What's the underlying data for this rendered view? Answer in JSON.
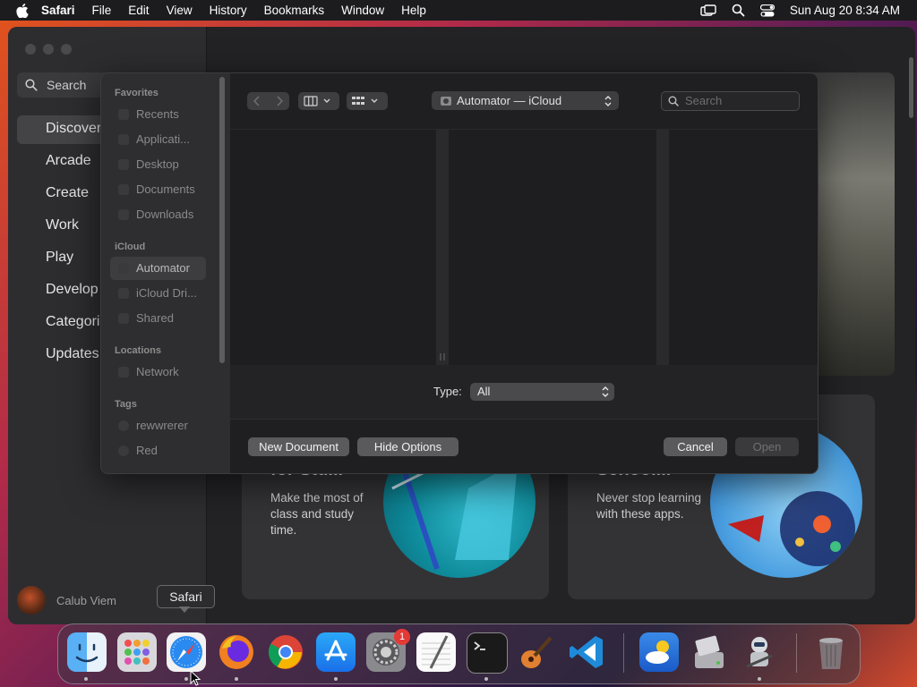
{
  "menubar": {
    "app_name": "Safari",
    "items": [
      "File",
      "Edit",
      "View",
      "History",
      "Bookmarks",
      "Window",
      "Help"
    ],
    "clock": "Sun Aug 20  8:34 AM"
  },
  "appstore": {
    "search_placeholder": "Search",
    "nav": [
      {
        "label": "Discover",
        "selected": true
      },
      {
        "label": "Arcade"
      },
      {
        "label": "Create"
      },
      {
        "label": "Work"
      },
      {
        "label": "Play"
      },
      {
        "label": "Develop"
      },
      {
        "label": "Categories"
      },
      {
        "label": "Updates"
      }
    ],
    "user": "Calub Viem",
    "cards": [
      {
        "title": "for Stu...",
        "text": "Make the most of class and study time."
      },
      {
        "title": "School...",
        "text": "Never stop learning with these apps."
      }
    ]
  },
  "dialog": {
    "sidebar": {
      "favorites_label": "Favorites",
      "favorites": [
        "Recents",
        "Applicati...",
        "Desktop",
        "Documents",
        "Downloads"
      ],
      "icloud_label": "iCloud",
      "icloud": [
        "Automator",
        "iCloud Dri...",
        "Shared"
      ],
      "locations_label": "Locations",
      "locations": [
        "Network"
      ],
      "tags_label": "Tags",
      "tags": [
        "rewwrerer",
        "Red"
      ]
    },
    "location": "Automator — iCloud",
    "search_placeholder": "Search",
    "type_label": "Type:",
    "type_value": "All",
    "buttons": {
      "new_document": "New Document",
      "hide_options": "Hide Options",
      "cancel": "Cancel",
      "open": "Open"
    }
  },
  "dock": {
    "tooltip": "Safari",
    "badge": "1"
  }
}
